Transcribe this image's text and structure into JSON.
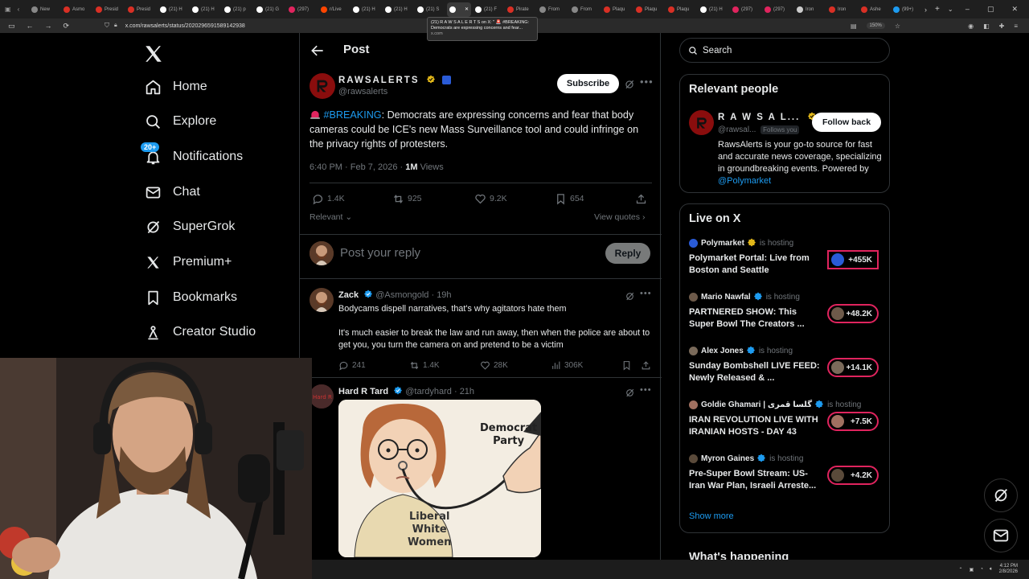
{
  "browser": {
    "tabs": [
      {
        "label": "New",
        "color": "#888888"
      },
      {
        "label": "Asmo",
        "color": "#d93025"
      },
      {
        "label": "Presid",
        "color": "#d93025"
      },
      {
        "label": "Presid",
        "color": "#d93025"
      },
      {
        "label": "(21) H",
        "color": "#ffffff"
      },
      {
        "label": "(21) H",
        "color": "#ffffff"
      },
      {
        "label": "(21) p",
        "color": "#ffffff"
      },
      {
        "label": "(21) G",
        "color": "#ffffff"
      },
      {
        "label": "(297)",
        "color": "#e0245e"
      },
      {
        "label": "r/Live",
        "color": "#ff4500"
      },
      {
        "label": "(21) H",
        "color": "#ffffff"
      },
      {
        "label": "(21) H",
        "color": "#ffffff"
      },
      {
        "label": "(21) S",
        "color": "#ffffff"
      },
      {
        "label": "",
        "color": "#ffffff",
        "active": true
      },
      {
        "label": "(21) F",
        "color": "#ffffff"
      },
      {
        "label": "Pirate",
        "color": "#d93025"
      },
      {
        "label": "From",
        "color": "#888888"
      },
      {
        "label": "From",
        "color": "#888888"
      },
      {
        "label": "Plaqu",
        "color": "#d93025"
      },
      {
        "label": "Plaqu",
        "color": "#d93025"
      },
      {
        "label": "Plaqu",
        "color": "#d93025"
      },
      {
        "label": "(21) H",
        "color": "#ffffff"
      },
      {
        "label": "(297)",
        "color": "#e0245e"
      },
      {
        "label": "(297)",
        "color": "#e0245e"
      },
      {
        "label": "Iron",
        "color": "#cccccc"
      },
      {
        "label": "Iron",
        "color": "#d93025"
      },
      {
        "label": "Ashe",
        "color": "#d93025"
      },
      {
        "label": "(99+)",
        "color": "#1d9bf0"
      }
    ],
    "url": "x.com/rawsalerts/status/2020296591589142938",
    "zoom": "150%",
    "tooltip": {
      "title": "(21) R A W S A L E R T S on X: \" 🚨 #BREAKING: Democrats are expressing concerns and fear...",
      "domain": "x.com"
    }
  },
  "nav": {
    "items": [
      {
        "label": "Home",
        "icon": "home-icon"
      },
      {
        "label": "Explore",
        "icon": "search-icon"
      },
      {
        "label": "Notifications",
        "icon": "bell-icon",
        "badge": "20+"
      },
      {
        "label": "Chat",
        "icon": "mail-icon"
      },
      {
        "label": "SuperGrok",
        "icon": "grok-icon"
      },
      {
        "label": "Premium+",
        "icon": "x-logo-icon"
      },
      {
        "label": "Bookmarks",
        "icon": "bookmark-icon"
      },
      {
        "label": "Creator Studio",
        "icon": "creator-icon"
      }
    ]
  },
  "post": {
    "header_title": "Post",
    "author_name": "RAWSALERTS",
    "author_handle": "@rawsalerts",
    "subscribe_label": "Subscribe",
    "text_hashtag": "#BREAKING",
    "text_body": ": Democrats are expressing concerns and fear that body cameras could be ICE's new Mass Surveillance tool and could infringe on the privacy rights of protesters.",
    "timestamp": "6:40 PM · Feb 7, 2026 · ",
    "views_count": "1M",
    "views_label": " Views",
    "stats": {
      "replies": "1.4K",
      "reposts": "925",
      "likes": "9.2K",
      "bookmarks": "654"
    },
    "sort_label": "Relevant",
    "view_quotes": "View quotes",
    "reply_placeholder": "Post your reply",
    "reply_button": "Reply"
  },
  "comments": [
    {
      "name": "Zack",
      "handle": "@Asmongold",
      "time": "· 19h",
      "line1": "Bodycams dispell narratives, that's why agitators hate them",
      "line2": "It's much easier to break the law and run away, then when the police are about to get you, you turn the camera on and pretend to be a victim",
      "stats": {
        "replies": "241",
        "reposts": "1.4K",
        "likes": "28K",
        "views": "306K"
      }
    },
    {
      "name": "Hard R Tard",
      "handle": "@tardyhard",
      "time": "· 21h",
      "image_caption_top": "Democrat\nParty",
      "image_caption_shirt": "Liberal\nWhite\nWomen"
    }
  ],
  "sidebar": {
    "search_placeholder": "Search",
    "relevant_title": "Relevant people",
    "rp_name": "R A W S A L...",
    "rp_handle": "@rawsal...",
    "rp_follows_you": "Follows you",
    "rp_follow_button": "Follow back",
    "rp_bio": "RawsAlerts is your go-to source for fast and accurate news coverage, specializing in groundbreaking events. Powered by ",
    "rp_bio_mention": "@Polymarket",
    "live_title": "Live on X",
    "live_items": [
      {
        "host": "Polymarket",
        "hosting": "is hosting",
        "title": "Polymarket Portal: Live from Boston and Seattle",
        "count": "+455K",
        "host_color": "#2a5bd7"
      },
      {
        "host": "Mario Nawfal",
        "hosting": "is hosting",
        "title": "PARTNERED SHOW: This Super Bowl The Creators ...",
        "count": "+48.2K",
        "host_color": "#6d5a4a"
      },
      {
        "host": "Alex Jones",
        "hosting": "is hosting",
        "title": "Sunday Bombshell LIVE FEED: Newly Released & ...",
        "count": "+14.1K",
        "host_color": "#7a6a5a"
      },
      {
        "host": "Goldie Ghamari | گلسا قمری",
        "hosting": "is hosting",
        "title": "IRAN REVOLUTION LIVE WITH IRANIAN HOSTS - DAY 43",
        "count": "+7.5K",
        "host_color": "#a07060"
      },
      {
        "host": "Myron Gaines",
        "hosting": "is hosting",
        "title": "Pre-Super Bowl Stream: US-Iran War Plan, Israeli Arreste...",
        "count": "+4.2K",
        "host_color": "#5a4a3a"
      }
    ],
    "show_more": "Show more",
    "whats_happening": "What's happening"
  },
  "taskbar": {
    "time": "4:12 PM",
    "date": "2/8/2026"
  }
}
